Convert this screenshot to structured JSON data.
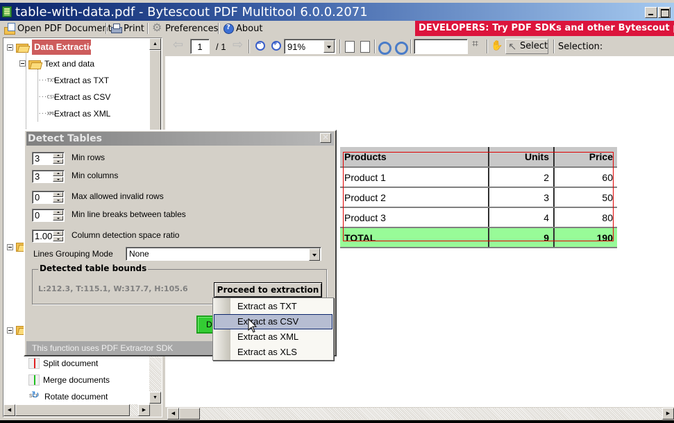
{
  "window": {
    "title": "table-with-data.pdf - Bytescout PDF Multitool 6.0.0.2071",
    "controls": [
      "minimize",
      "maximize"
    ]
  },
  "menubar": {
    "items": [
      {
        "label": "Open PDF Document",
        "icon": "open-document-icon"
      },
      {
        "label": "Print",
        "icon": "printer-icon"
      },
      {
        "label": "Preferences",
        "icon": "gear-icon"
      },
      {
        "label": "About",
        "icon": "help-icon"
      }
    ],
    "promo": "DEVELOPERS: Try PDF SDKs and other Bytescout products",
    "promo_color": "#dc143c"
  },
  "tree": {
    "root": {
      "label": "Data Extraction",
      "selected": true
    },
    "group": {
      "label": "Text and data"
    },
    "items": [
      {
        "label": "Extract as TXT",
        "type": "TXT"
      },
      {
        "label": "Extract as CSV",
        "type": "CSV"
      },
      {
        "label": "Extract as XML",
        "type": "XML"
      }
    ],
    "bottom_items": [
      {
        "label": "Split document",
        "icon": "split-icon"
      },
      {
        "label": "Merge documents",
        "icon": "merge-icon"
      },
      {
        "label": "Rotate document",
        "icon": "rotate-icon"
      }
    ]
  },
  "viewer_toolbar": {
    "page": "1",
    "page_total": "/ 1",
    "zoom": "91%",
    "search_value": "",
    "select_label": "Select",
    "selection_label": "Selection:"
  },
  "pdf_table": {
    "headers": [
      "Products",
      "Units",
      "Price"
    ],
    "rows": [
      [
        "Product 1",
        "2",
        "60"
      ],
      [
        "Product 2",
        "3",
        "50"
      ],
      [
        "Product 3",
        "4",
        "80"
      ]
    ],
    "total": [
      "TOTAL",
      "9",
      "190"
    ],
    "header_color": "#c8c8c8",
    "total_color": "#98fb98"
  },
  "dialog": {
    "title": "Detect Tables",
    "fields": [
      {
        "label": "Min rows",
        "value": "3"
      },
      {
        "label": "Min columns",
        "value": "3"
      },
      {
        "label": "Max allowed invalid rows",
        "value": "0"
      },
      {
        "label": "Min line breaks between tables",
        "value": "0"
      },
      {
        "label": "Column detection space ratio",
        "value": "1.00"
      }
    ],
    "grouping_label": "Lines Grouping Mode",
    "grouping_value": "None",
    "bounds_title": "Detected table bounds",
    "bounds_value": "L:212.3, T:115.1, W:317.7, H:105.6",
    "proceed_label": "Proceed to extraction",
    "detect_label": "Detect",
    "footer": "This function uses PDF Extractor SDK"
  },
  "extract_menu": {
    "items": [
      "Extract as TXT",
      "Extract as CSV",
      "Extract as XML",
      "Extract as XLS"
    ],
    "hovered": "Extract as CSV"
  }
}
